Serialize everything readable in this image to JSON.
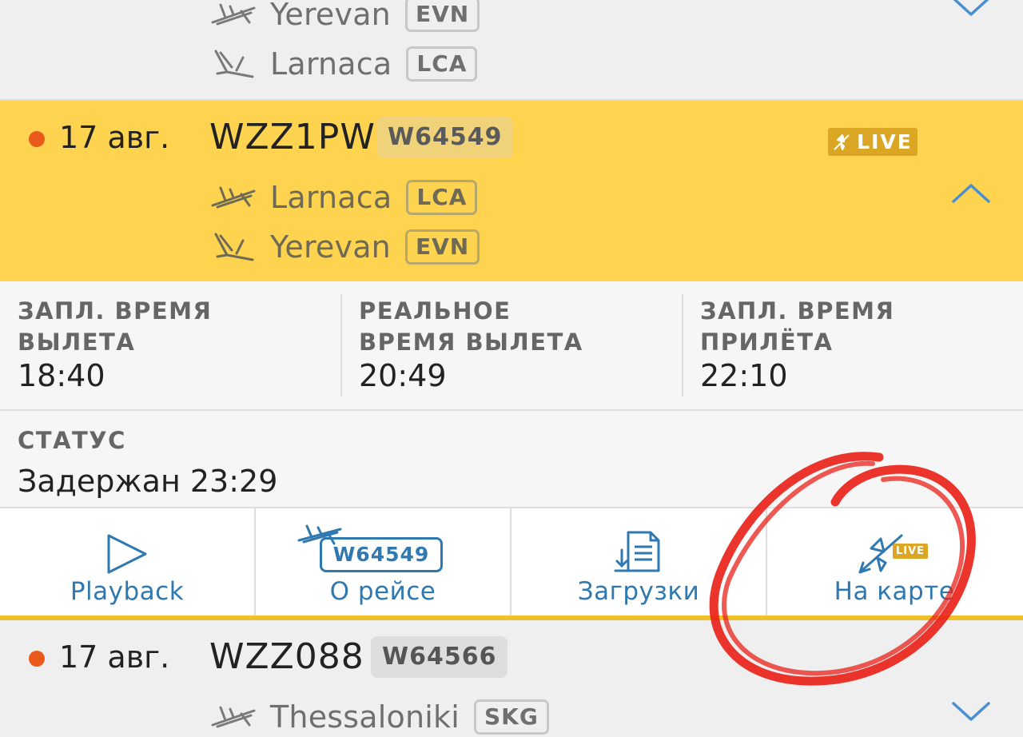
{
  "flights": [
    {
      "id": "prev",
      "from": {
        "city": "Yerevan",
        "iata": "EVN"
      },
      "to": {
        "city": "Larnaca",
        "iata": "LCA"
      }
    },
    {
      "id": "active",
      "date": "17 авг.",
      "callsign": "WZZ1PW",
      "flight_number": "W64549",
      "live_label": "LIVE",
      "from": {
        "city": "Larnaca",
        "iata": "LCA"
      },
      "to": {
        "city": "Yerevan",
        "iata": "EVN"
      }
    },
    {
      "id": "next",
      "date": "17 авг.",
      "callsign": "WZZ088",
      "flight_number": "W64566",
      "from": {
        "city": "Thessaloniki",
        "iata": "SKG"
      }
    }
  ],
  "details": {
    "sched_dep_label": "ЗАПЛ. ВРЕМЯ ВЫЛЕТА",
    "sched_dep_value": "18:40",
    "actual_dep_label_1": "РЕАЛЬНОЕ",
    "actual_dep_label_2": "ВРЕМЯ ВЫЛЕТА",
    "actual_dep_value": "20:49",
    "sched_arr_label_1": "ЗАПЛ. ВРЕМЯ",
    "sched_arr_label_2": "ПРИЛЁТА",
    "sched_arr_value": "22:10",
    "status_label": "СТАТУС",
    "status_value": "Задержан 23:29"
  },
  "actions": {
    "playback": "Playback",
    "about_flight": "О рейсе",
    "about_flight_badge": "W64549",
    "downloads": "Загрузки",
    "on_map": "На карте",
    "on_map_badge": "LIVE"
  },
  "colors": {
    "active_row": "#fdd34f",
    "accent_blue": "#2f78b0",
    "live_badge": "#dba624",
    "status_dot": "#ea5a1a",
    "annotation_circle": "#e8231a"
  },
  "icons": [
    "takeoff-icon",
    "landing-icon",
    "chevron-down-icon",
    "chevron-up-icon",
    "play-icon",
    "plane-icon",
    "download-document-icon",
    "plane-live-icon"
  ]
}
